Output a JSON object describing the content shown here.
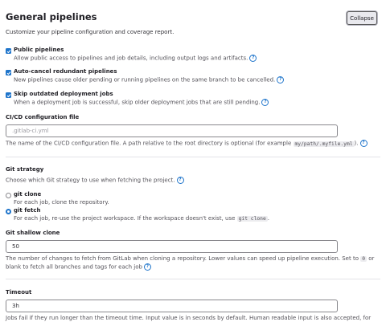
{
  "header": {
    "title": "General pipelines",
    "subtitle": "Customize your pipeline configuration and coverage report.",
    "collapse_label": "Collapse"
  },
  "options": {
    "public_pipelines": {
      "label": "Public pipelines",
      "help": "Allow public access to pipelines and job details, including output logs and artifacts.",
      "checked": true
    },
    "auto_cancel": {
      "label": "Auto-cancel redundant pipelines",
      "help": "New pipelines cause older pending or running pipelines on the same branch to be cancelled.",
      "checked": true
    },
    "skip_outdated": {
      "label": "Skip outdated deployment jobs",
      "help": "When a deployment job is successful, skip older deployment jobs that are still pending.",
      "checked": true
    }
  },
  "ci_config": {
    "label": "CI/CD configuration file",
    "value": "",
    "placeholder": ".gitlab-ci.yml",
    "help_prefix": "The name of the CI/CD configuration file. A path relative to the root directory is optional (for example",
    "help_code": "my/path/.myfile.yml",
    "help_suffix": ")."
  },
  "git_strategy": {
    "label": "Git strategy",
    "help": "Choose which Git strategy to use when fetching the project.",
    "selected": "git fetch",
    "clone": {
      "label": "git clone",
      "help": "For each job, clone the repository."
    },
    "fetch": {
      "label": "git fetch",
      "help_prefix": "For each job, re-use the project workspace. If the workspace doesn't exist, use",
      "help_code": "git clone",
      "help_suffix": "."
    }
  },
  "shallow_clone": {
    "label": "Git shallow clone",
    "value": "50",
    "help_line1_prefix": "The number of changes to fetch from GitLab when cloning a repository. Lower values can speed up pipeline execution. Set to",
    "help_line1_code": "0",
    "help_line1_suffix": "or",
    "help_line2": "blank to fetch all branches and tags for each job"
  },
  "timeout": {
    "label": "Timeout",
    "value": "3h",
    "help": "Jobs fail if they run longer than the timeout time. Input value is in seconds by default. Human readable input is also accepted, for"
  },
  "icons": {
    "help": "question-circle-icon",
    "check": "check-icon"
  },
  "colors": {
    "accent": "#1f75cb",
    "text": "#333238",
    "border": "#89888d"
  }
}
